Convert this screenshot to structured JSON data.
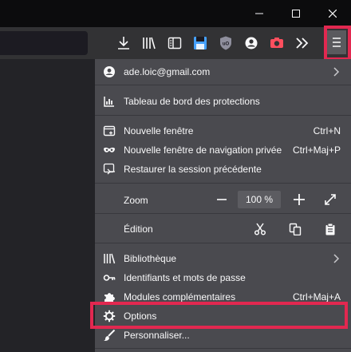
{
  "window": {
    "controls": [
      "minimize-icon",
      "maximize-icon",
      "close-icon"
    ]
  },
  "toolbar": {
    "icons": [
      "download-icon",
      "library-icon",
      "sidebar-icon",
      "save-icon",
      "ublock-icon",
      "account-icon",
      "screenshot-icon",
      "overflow-icon",
      "hamburger-menu-icon"
    ]
  },
  "menu": {
    "account": {
      "email": "ade.loic@gmail.com"
    },
    "protections": {
      "label": "Tableau de bord des protections"
    },
    "new_window": {
      "label": "Nouvelle fenêtre",
      "shortcut": "Ctrl+N"
    },
    "private_window": {
      "label": "Nouvelle fenêtre de navigation privée",
      "shortcut": "Ctrl+Maj+P"
    },
    "restore_session": {
      "label": "Restaurer la session précédente"
    },
    "zoom": {
      "label": "Zoom",
      "value": "100 %"
    },
    "edition": {
      "label": "Édition"
    },
    "library": {
      "label": "Bibliothèque"
    },
    "logins": {
      "label": "Identifiants et mots de passe"
    },
    "addons": {
      "label": "Modules complémentaires",
      "shortcut": "Ctrl+Maj+A"
    },
    "options": {
      "label": "Options"
    },
    "customize": {
      "label": "Personnaliser..."
    }
  },
  "colors": {
    "highlight": "#e22850",
    "panel": "#4a4a4f",
    "toolbar": "#323234",
    "screenshot_accent": "#ff4f5e",
    "save_accent": "#45a1ff"
  }
}
